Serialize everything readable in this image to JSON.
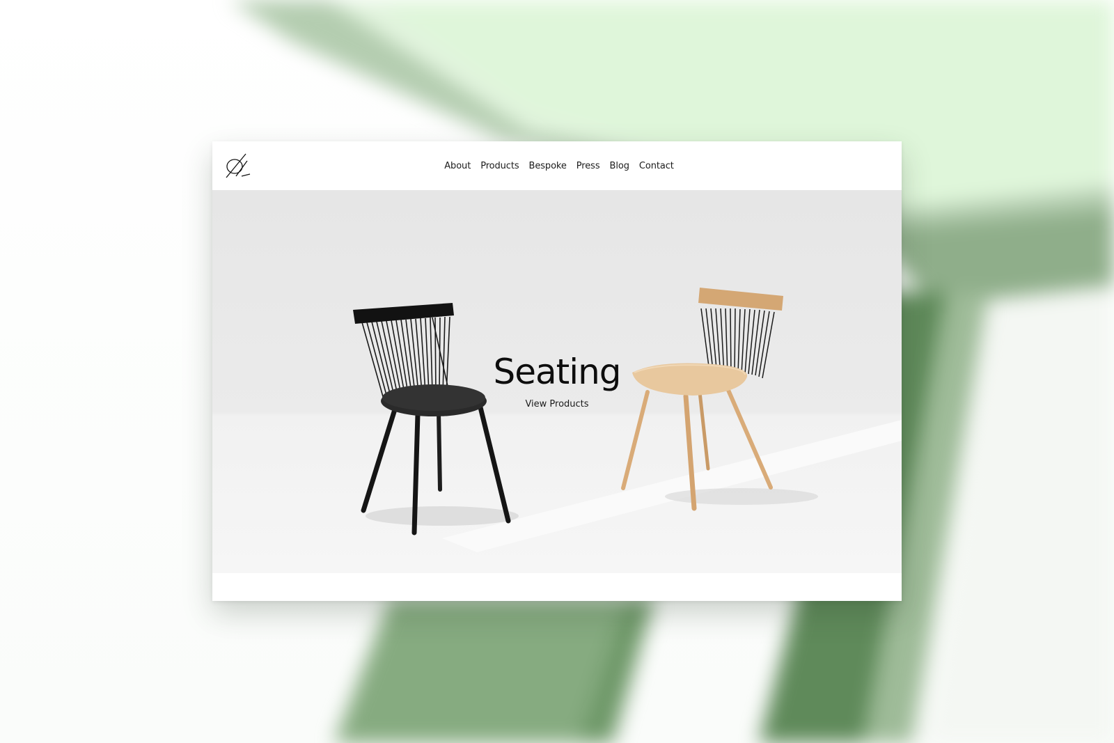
{
  "site": {
    "logo_icon": "monogram-logo-icon",
    "nav": [
      {
        "label": "About"
      },
      {
        "label": "Products"
      },
      {
        "label": "Bespoke"
      },
      {
        "label": "Press"
      },
      {
        "label": "Blog"
      },
      {
        "label": "Contact"
      }
    ],
    "hero": {
      "title": "Seating",
      "link_label": "View Products",
      "image_subject": "black chair and natural oak chair"
    }
  },
  "colors": {
    "backdrop_green": "#8fb58a",
    "backdrop_light_green": "#e1f5dd",
    "hero_background": "#ebebeb",
    "text": "#1b1b1b"
  }
}
